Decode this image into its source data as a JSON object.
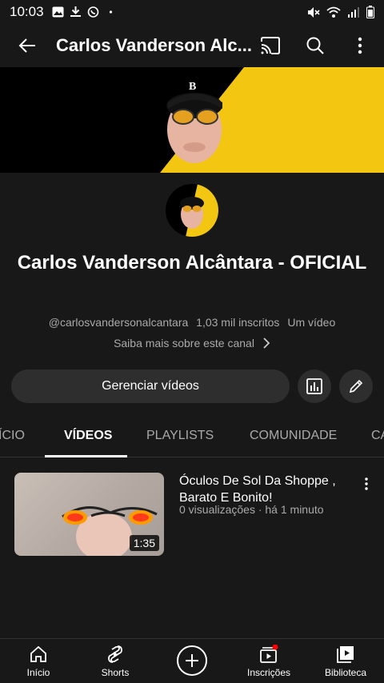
{
  "status_bar": {
    "time": "10:03"
  },
  "app_bar": {
    "title": "Carlos Vanderson Alc..."
  },
  "channel": {
    "name": "Carlos Vanderson Alcântara - OFICIAL",
    "handle": "@carlosvandersonalcantara",
    "subscribers": "1,03 mil inscritos",
    "video_count": "Um vídeo",
    "more_link": "Saiba mais sobre este canal"
  },
  "actions": {
    "manage_videos": "Gerenciar vídeos"
  },
  "tabs": [
    {
      "label": "ÍCIO"
    },
    {
      "label": "VÍDEOS"
    },
    {
      "label": "PLAYLISTS"
    },
    {
      "label": "COMUNIDADE"
    },
    {
      "label": "CA"
    }
  ],
  "videos": [
    {
      "title": "Óculos De Sol Da Shoppe , Barato E Bonito!",
      "views": "0 visualizações",
      "age": "há 1 minuto",
      "separator": "·",
      "duration": "1:35"
    }
  ],
  "bottom_nav": [
    {
      "label": "Início",
      "icon": "home-icon"
    },
    {
      "label": "Shorts",
      "icon": "shorts-icon"
    },
    {
      "label": "",
      "icon": "create-icon"
    },
    {
      "label": "Inscrições",
      "icon": "subscriptions-icon"
    },
    {
      "label": "Biblioteca",
      "icon": "library-icon"
    }
  ],
  "colors": {
    "background": "#181818",
    "banner_accent": "#f2c611",
    "notification_dot": "#ff0000"
  }
}
